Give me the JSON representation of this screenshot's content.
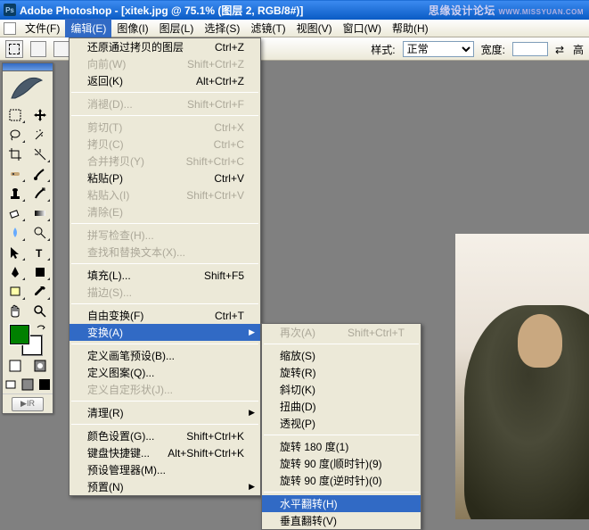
{
  "title": "Adobe Photoshop - [xitek.jpg @ 75.1% (图层 2, RGB/8#)]",
  "watermark": {
    "main": "思缘设计论坛",
    "sub": "WWW.MISSYUAN.COM"
  },
  "menubar": {
    "items": [
      {
        "label": "文件(F)"
      },
      {
        "label": "编辑(E)",
        "open": true
      },
      {
        "label": "图像(I)"
      },
      {
        "label": "图层(L)"
      },
      {
        "label": "选择(S)"
      },
      {
        "label": "滤镜(T)"
      },
      {
        "label": "视图(V)"
      },
      {
        "label": "窗口(W)"
      },
      {
        "label": "帮助(H)"
      }
    ]
  },
  "options": {
    "style_label": "样式:",
    "style_value": "正常",
    "width_label": "宽度:",
    "height_label": "高"
  },
  "edit_menu": [
    {
      "label": "还原通过拷贝的图层",
      "shortcut": "Ctrl+Z"
    },
    {
      "label": "向前(W)",
      "shortcut": "Shift+Ctrl+Z",
      "disabled": true
    },
    {
      "label": "返回(K)",
      "shortcut": "Alt+Ctrl+Z"
    },
    {
      "sep": true
    },
    {
      "label": "消褪(D)...",
      "shortcut": "Shift+Ctrl+F",
      "disabled": true
    },
    {
      "sep": true
    },
    {
      "label": "剪切(T)",
      "shortcut": "Ctrl+X",
      "disabled": true
    },
    {
      "label": "拷贝(C)",
      "shortcut": "Ctrl+C",
      "disabled": true
    },
    {
      "label": "合并拷贝(Y)",
      "shortcut": "Shift+Ctrl+C",
      "disabled": true
    },
    {
      "label": "粘贴(P)",
      "shortcut": "Ctrl+V"
    },
    {
      "label": "粘贴入(I)",
      "shortcut": "Shift+Ctrl+V",
      "disabled": true
    },
    {
      "label": "清除(E)",
      "disabled": true
    },
    {
      "sep": true
    },
    {
      "label": "拼写检查(H)...",
      "disabled": true
    },
    {
      "label": "查找和替换文本(X)...",
      "disabled": true
    },
    {
      "sep": true
    },
    {
      "label": "填充(L)...",
      "shortcut": "Shift+F5"
    },
    {
      "label": "描边(S)...",
      "disabled": true
    },
    {
      "sep": true
    },
    {
      "label": "自由变换(F)",
      "shortcut": "Ctrl+T"
    },
    {
      "label": "变换(A)",
      "selected": true,
      "submenu": true
    },
    {
      "sep": true
    },
    {
      "label": "定义画笔预设(B)..."
    },
    {
      "label": "定义图案(Q)..."
    },
    {
      "label": "定义自定形状(J)...",
      "disabled": true
    },
    {
      "sep": true
    },
    {
      "label": "清理(R)",
      "submenu": true
    },
    {
      "sep": true
    },
    {
      "label": "颜色设置(G)...",
      "shortcut": "Shift+Ctrl+K"
    },
    {
      "label": "键盘快捷键...",
      "shortcut": "Alt+Shift+Ctrl+K"
    },
    {
      "label": "预设管理器(M)..."
    },
    {
      "label": "预置(N)",
      "submenu": true
    }
  ],
  "transform_submenu": [
    {
      "label": "再次(A)",
      "shortcut": "Shift+Ctrl+T",
      "disabled": true
    },
    {
      "sep": true
    },
    {
      "label": "缩放(S)"
    },
    {
      "label": "旋转(R)"
    },
    {
      "label": "斜切(K)"
    },
    {
      "label": "扭曲(D)"
    },
    {
      "label": "透视(P)"
    },
    {
      "sep": true
    },
    {
      "label": "旋转 180 度(1)"
    },
    {
      "label": "旋转 90 度(顺时针)(9)"
    },
    {
      "label": "旋转 90 度(逆时针)(0)"
    },
    {
      "sep": true
    },
    {
      "label": "水平翻转(H)",
      "selected": true
    },
    {
      "label": "垂直翻转(V)"
    }
  ],
  "toolbox": {
    "colors": {
      "fg": "#008000",
      "bg": "#ffffff"
    }
  }
}
